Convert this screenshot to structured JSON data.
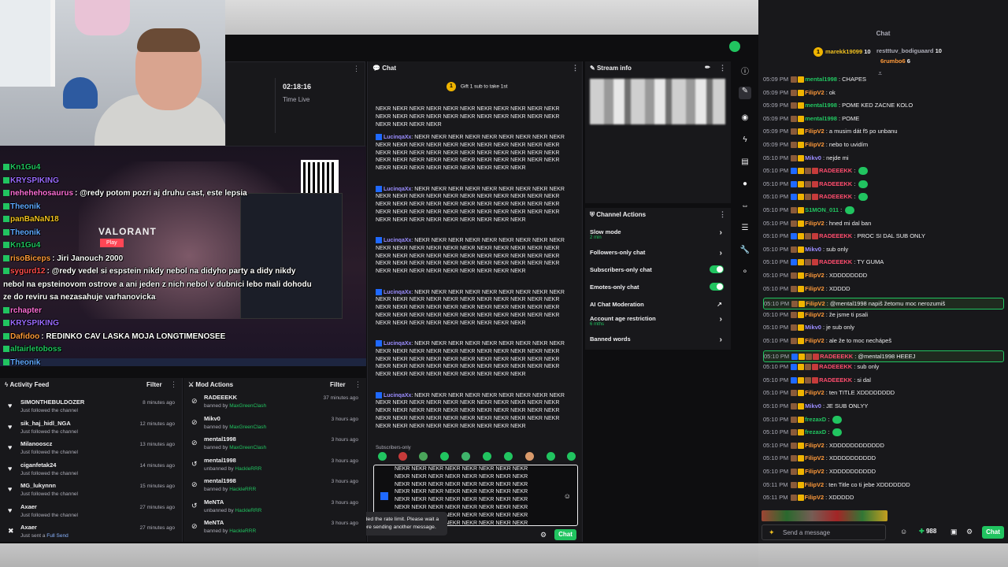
{
  "dashboard": {
    "stream_time": "02:18:16",
    "stream_time_label": "Time Live",
    "chat_header": "Chat",
    "stream_info_header": "Stream info",
    "channel_actions_header": "Channel Actions",
    "gift_text": "Gift 1 sub to take 1st",
    "gift_count": "1",
    "subscribers_only_label": "Subscribers-only",
    "rate_limit_msg": "You've exceeded the rate limit. Please wait a moment before sending another message.",
    "chat_button": "Chat",
    "spam_word_block": "NEKR NEKR NEKR NEKR NEKR NEKR NEKR NEKR NEKR NEKR NEKR NEKR NEKR NEKR NEKR NEKR NEKR NEKR NEKR NEKR NEKR NEKR NEKR NEKR NEKR NEKR NEKR NEKR NEKR NEKR NEKR NEKR NEKR NEKR NEKR NEKR NEKR NEKR NEKR NEKR NEKR NEKR NEKR NEKR NEKR NEKR NEKR NEKR NEKR NEKR NEKR",
    "spam_first": "NEKR NEKR NEKR NEKR NEKR NEKR NEKR NEKR NEKR NEKR NEKR NEKR NEKR NEKR NEKR NEKR NEKR NEKR NEKR NEKR NEKR NEKR NEKR NEKR NEKR NEKR",
    "spam_user": "LucinqaXx",
    "input_text": "NEKR NEKR NEKR NEKR NEKR NEKR NEKR NEKR NEKR NEKR NEKR NEKR NEKR NEKR NEKR NEKR NEKR NEKR NEKR NEKR NEKR NEKR NEKR NEKR NEKR NEKR NEKR NEKR NEKR NEKR NEKR NEKR NEKR NEKR NEKR NEKR NEKR NEKR NEKR NEKR NEKR NEKR NEKR NEKR NEKR NEKR NEKR NEKR NEKR NEKR NEKR NEKR NEKR NEKR NEKR NEKR NEKR NEKR NEKR NEKR NEKR NEKR NEKR NEKR NEKR EKR NEKR"
  },
  "channel_actions": [
    {
      "label": "Slow mode",
      "sub": "2 min",
      "control": "arrow"
    },
    {
      "label": "Followers-only chat",
      "sub": "",
      "control": "arrow"
    },
    {
      "label": "Subscribers-only chat",
      "sub": "",
      "control": "toggle-on"
    },
    {
      "label": "Emotes-only chat",
      "sub": "",
      "control": "toggle-on"
    },
    {
      "label": "AI Chat Moderation",
      "sub": "",
      "control": "external"
    },
    {
      "label": "Account age restriction",
      "sub": "6 mths",
      "control": "arrow"
    },
    {
      "label": "Banned words",
      "sub": "",
      "control": "arrow"
    }
  ],
  "activity_feed": {
    "title": "Activity Feed",
    "filter": "Filter",
    "items": [
      {
        "name": "SIMONTHEBULDOZER",
        "action": "Just followed the channel",
        "ago": "8 minutes ago"
      },
      {
        "name": "sik_haj_hidl_NGA",
        "action": "Just followed the channel",
        "ago": "12 minutes ago"
      },
      {
        "name": "Milanooscz",
        "action": "Just followed the channel",
        "ago": "13 minutes ago"
      },
      {
        "name": "ciganfetak24",
        "action": "Just followed the channel",
        "ago": "14 minutes ago"
      },
      {
        "name": "MG_lukynnn",
        "action": "Just followed the channel",
        "ago": "15 minutes ago"
      },
      {
        "name": "Axaer",
        "action": "Just followed the channel",
        "ago": "27 minutes ago"
      },
      {
        "name": "Axaer",
        "action": "Just sent a",
        "highlight": "Full Send",
        "ago": "27 minutes ago"
      }
    ]
  },
  "mod_actions": {
    "title": "Mod Actions",
    "filter": "Filter",
    "items": [
      {
        "name": "RADEEEKK",
        "action": "banned by",
        "by": "MaxGreenClash",
        "ago": "37 minutes ago",
        "icon": "ban"
      },
      {
        "name": "Mikv0",
        "action": "banned by",
        "by": "MaxGreenClash",
        "ago": "3 hours ago",
        "icon": "ban"
      },
      {
        "name": "mental1998",
        "action": "banned by",
        "by": "MaxGreenClash",
        "ago": "3 hours ago",
        "icon": "ban"
      },
      {
        "name": "mental1998",
        "action": "unbanned by",
        "by": "HackleRRR",
        "ago": "3 hours ago",
        "icon": "undo"
      },
      {
        "name": "mental1998",
        "action": "banned by",
        "by": "HackleRRR",
        "ago": "3 hours ago",
        "icon": "ban"
      },
      {
        "name": "MeNTA",
        "action": "unbanned by",
        "by": "HackleRRR",
        "ago": "3 hours ago",
        "icon": "undo"
      },
      {
        "name": "MeNTA",
        "action": "banned by",
        "by": "HackleRRR",
        "ago": "3 hours ago",
        "icon": "ban"
      }
    ]
  },
  "overlay_chat": [
    {
      "user": "Kn1Gu4",
      "color": "#21c460",
      "msg": ""
    },
    {
      "user": "KRYSPIKING",
      "color": "#9b6bff",
      "msg": ""
    },
    {
      "user": "nehehehosaurus",
      "color": "#ff6fd8",
      "msg": ": @redy potom pozri aj druhu cast, este lepsia"
    },
    {
      "user": "Theonik",
      "color": "#5fa8ff",
      "msg": ""
    },
    {
      "user": "panBaNaN18",
      "color": "#f0c020",
      "msg": ""
    },
    {
      "user": "Theonik",
      "color": "#5fa8ff",
      "msg": ""
    },
    {
      "user": "Kn1Gu4",
      "color": "#21c460",
      "msg": ""
    },
    {
      "user": "risoBiceps",
      "color": "#ff9a3a",
      "msg": ": Jiri Janouch 2000"
    },
    {
      "user": "sygurd12",
      "color": "#ff4d4d",
      "msg": ": @redy vedel si espstein nikdy nebol na didyho party a didy nikdy"
    },
    {
      "user": "",
      "color": "#fff",
      "msg": "nebol na epsteinovom ostrove a ani jeden z nich nebol v dubnici lebo mali dohodu"
    },
    {
      "user": "",
      "color": "#fff",
      "msg": "ze do reviru sa nezasahuje varhanovicka"
    },
    {
      "user": "rchapter",
      "color": "#ff6fd8",
      "msg": ""
    },
    {
      "user": "KRYSPIKING",
      "color": "#9b6bff",
      "msg": ""
    },
    {
      "user": "Dafidoo",
      "color": "#ff9a3a",
      "msg": ": REDINKO CAV LASKA MOJA LONGTIMENOSEE"
    },
    {
      "user": "altairletoboss",
      "color": "#21c460",
      "msg": ""
    },
    {
      "user": "Theonik",
      "color": "#5fa8ff",
      "msg": ""
    }
  ],
  "game": {
    "title": "VALORANT",
    "play": "Play"
  },
  "right_chat": {
    "title": "Chat",
    "leaders": [
      {
        "name": "marekk19099",
        "count": "10",
        "color": "#f0c020"
      },
      {
        "name": "restttuv_bodiguaard",
        "count": "10",
        "color": "#adadb8"
      },
      {
        "name": "6rumbo6",
        "count": "6",
        "color": "#ff9a3a"
      }
    ],
    "input_placeholder": "Send a message",
    "points": "988",
    "chat_button": "Chat",
    "messages": [
      {
        "time": "05:09 PM",
        "user": "mental1998",
        "color": "#21c460",
        "text": ": CHAPES"
      },
      {
        "time": "05:09 PM",
        "user": "FilipV2",
        "color": "#ff9a3a",
        "text": ": ok"
      },
      {
        "time": "05:09 PM",
        "user": "mental1998",
        "color": "#21c460",
        "text": ": POME KED ZACNE KOLO"
      },
      {
        "time": "05:09 PM",
        "user": "mental1998",
        "color": "#21c460",
        "text": ": POME"
      },
      {
        "time": "05:09 PM",
        "user": "FilipV2",
        "color": "#ff9a3a",
        "text": ": a musim dát f5 po unbanu"
      },
      {
        "time": "05:09 PM",
        "user": "FilipV2",
        "color": "#ff9a3a",
        "text": ": nebo to uvidím"
      },
      {
        "time": "05:10 PM",
        "user": "Mikv0",
        "color": "#9b8dff",
        "text": ": nejde mi"
      },
      {
        "time": "05:10 PM",
        "user": "RADEEEKK",
        "color": "#ff4d6d",
        "text": ":"
      },
      {
        "time": "05:10 PM",
        "user": "RADEEEKK",
        "color": "#ff4d6d",
        "text": ":"
      },
      {
        "time": "05:10 PM",
        "user": "RADEEEKK",
        "color": "#ff4d6d",
        "text": ":"
      },
      {
        "time": "05:10 PM",
        "user": "S1MON_011",
        "color": "#21c460",
        "text": ":"
      },
      {
        "time": "05:10 PM",
        "user": "FilipV2",
        "color": "#ff9a3a",
        "text": ": hned mi dal ban"
      },
      {
        "time": "05:10 PM",
        "user": "RADEEEKK",
        "color": "#ff4d6d",
        "text": ": PROC SI DAL SUB ONLY"
      },
      {
        "time": "05:10 PM",
        "user": "Mikv0",
        "color": "#9b8dff",
        "text": ": sub only"
      },
      {
        "time": "05:10 PM",
        "user": "RADEEEKK",
        "color": "#ff4d6d",
        "text": ": TY GUMA"
      },
      {
        "time": "05:10 PM",
        "user": "FilipV2",
        "color": "#ff9a3a",
        "text": ": XDDDDDDDD"
      },
      {
        "time": "05:10 PM",
        "user": "FilipV2",
        "color": "#ff9a3a",
        "text": ": XDDDD"
      },
      {
        "time": "05:10 PM",
        "user": "FilipV2",
        "color": "#ff9a3a",
        "text": ": @mental1998 napiš žetomu moc nerozumiš",
        "hl": true
      },
      {
        "time": "05:10 PM",
        "user": "FilipV2",
        "color": "#ff9a3a",
        "text": ": že jsme ti psali"
      },
      {
        "time": "05:10 PM",
        "user": "Mikv0",
        "color": "#9b8dff",
        "text": ": je sub only"
      },
      {
        "time": "05:10 PM",
        "user": "FilipV2",
        "color": "#ff9a3a",
        "text": ": ale že to moc nechápeš"
      },
      {
        "time": "05:10 PM",
        "user": "RADEEEKK",
        "color": "#ff4d6d",
        "text": ": @mental1998 HEEEJ",
        "hl": true
      },
      {
        "time": "05:10 PM",
        "user": "RADEEEKK",
        "color": "#ff4d6d",
        "text": ": sub only"
      },
      {
        "time": "05:10 PM",
        "user": "RADEEEKK",
        "color": "#ff4d6d",
        "text": ": si dal"
      },
      {
        "time": "05:10 PM",
        "user": "FilipV2",
        "color": "#ff9a3a",
        "text": ": ten TITLE XDDDDDDDD"
      },
      {
        "time": "05:10 PM",
        "user": "Mikv0",
        "color": "#9b8dff",
        "text": ": JE SUB ONLYY"
      },
      {
        "time": "05:10 PM",
        "user": "frezaxD",
        "color": "#21c460",
        "text": ":"
      },
      {
        "time": "05:10 PM",
        "user": "frezaxD",
        "color": "#21c460",
        "text": ":"
      },
      {
        "time": "05:10 PM",
        "user": "FilipV2",
        "color": "#ff9a3a",
        "text": ": XDDDDDDDDDDDD"
      },
      {
        "time": "05:10 PM",
        "user": "FilipV2",
        "color": "#ff9a3a",
        "text": ": XDDDDDDDDDD"
      },
      {
        "time": "05:10 PM",
        "user": "FilipV2",
        "color": "#ff9a3a",
        "text": ": XDDDDDDDDDD"
      },
      {
        "time": "05:11 PM",
        "user": "FilipV2",
        "color": "#ff9a3a",
        "text": ": ten Title co ti jebe XDDDDDDD"
      },
      {
        "time": "05:11 PM",
        "user": "FilipV2",
        "color": "#ff9a3a",
        "text": ": XDDDDD"
      }
    ]
  },
  "colors": {
    "accent": "#21c460",
    "bg": "#18181b",
    "panel_border": "#26262c",
    "link": "#9b8dff"
  }
}
